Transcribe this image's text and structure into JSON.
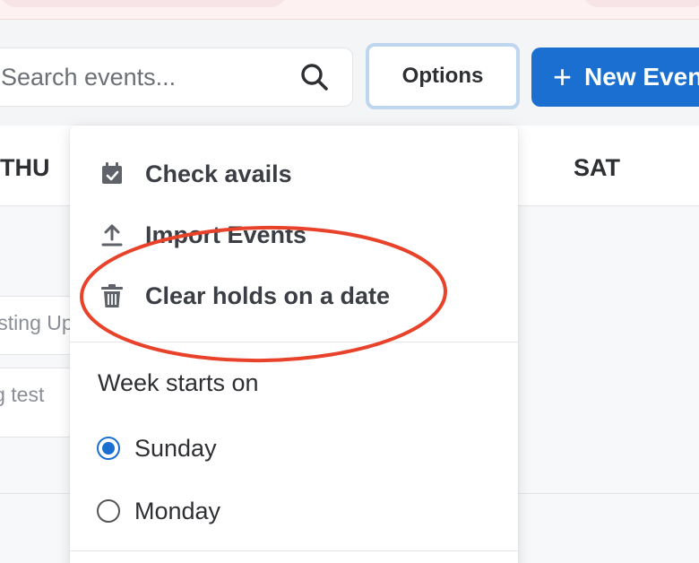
{
  "toolbar": {
    "search_placeholder": "Search events...",
    "options_label": "Options",
    "new_event_label": "New Event"
  },
  "calendar": {
    "days": [
      "THU",
      "SAT"
    ],
    "event_chips": [
      "Tasting Upgrade",
      "Tasting test"
    ]
  },
  "menu": {
    "items": [
      {
        "label": "Check avails",
        "icon": "calendar-check-icon"
      },
      {
        "label": "Import Events",
        "icon": "upload-icon"
      },
      {
        "label": "Clear holds on a date",
        "icon": "trash-icon"
      }
    ],
    "week_start": {
      "title": "Week starts on",
      "options": [
        {
          "label": "Sunday",
          "selected": true
        },
        {
          "label": "Monday",
          "selected": false
        }
      ]
    }
  },
  "annotation": {
    "shape": "ellipse",
    "color": "#e8432a",
    "target": "Clear holds on a date"
  },
  "colors": {
    "primary": "#1a6fd0",
    "focus_ring": "#bfd6ef",
    "annotation": "#e8432a",
    "menu_text": "#3b3e44"
  }
}
